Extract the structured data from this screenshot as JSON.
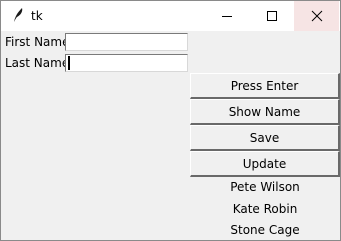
{
  "window": {
    "title": "tk",
    "icon": "feather-icon",
    "controls": [
      "minimize-icon",
      "maximize-icon",
      "close-icon"
    ]
  },
  "form": {
    "first_name_label": "First Name",
    "first_name_value": "",
    "last_name_label": "Last Name",
    "last_name_value": ""
  },
  "buttons": {
    "press_enter": "Press Enter",
    "show_name": "Show Name",
    "save": "Save",
    "update": "Update"
  },
  "names": [
    "Pete Wilson",
    "Kate Robin",
    "Stone Cage"
  ]
}
